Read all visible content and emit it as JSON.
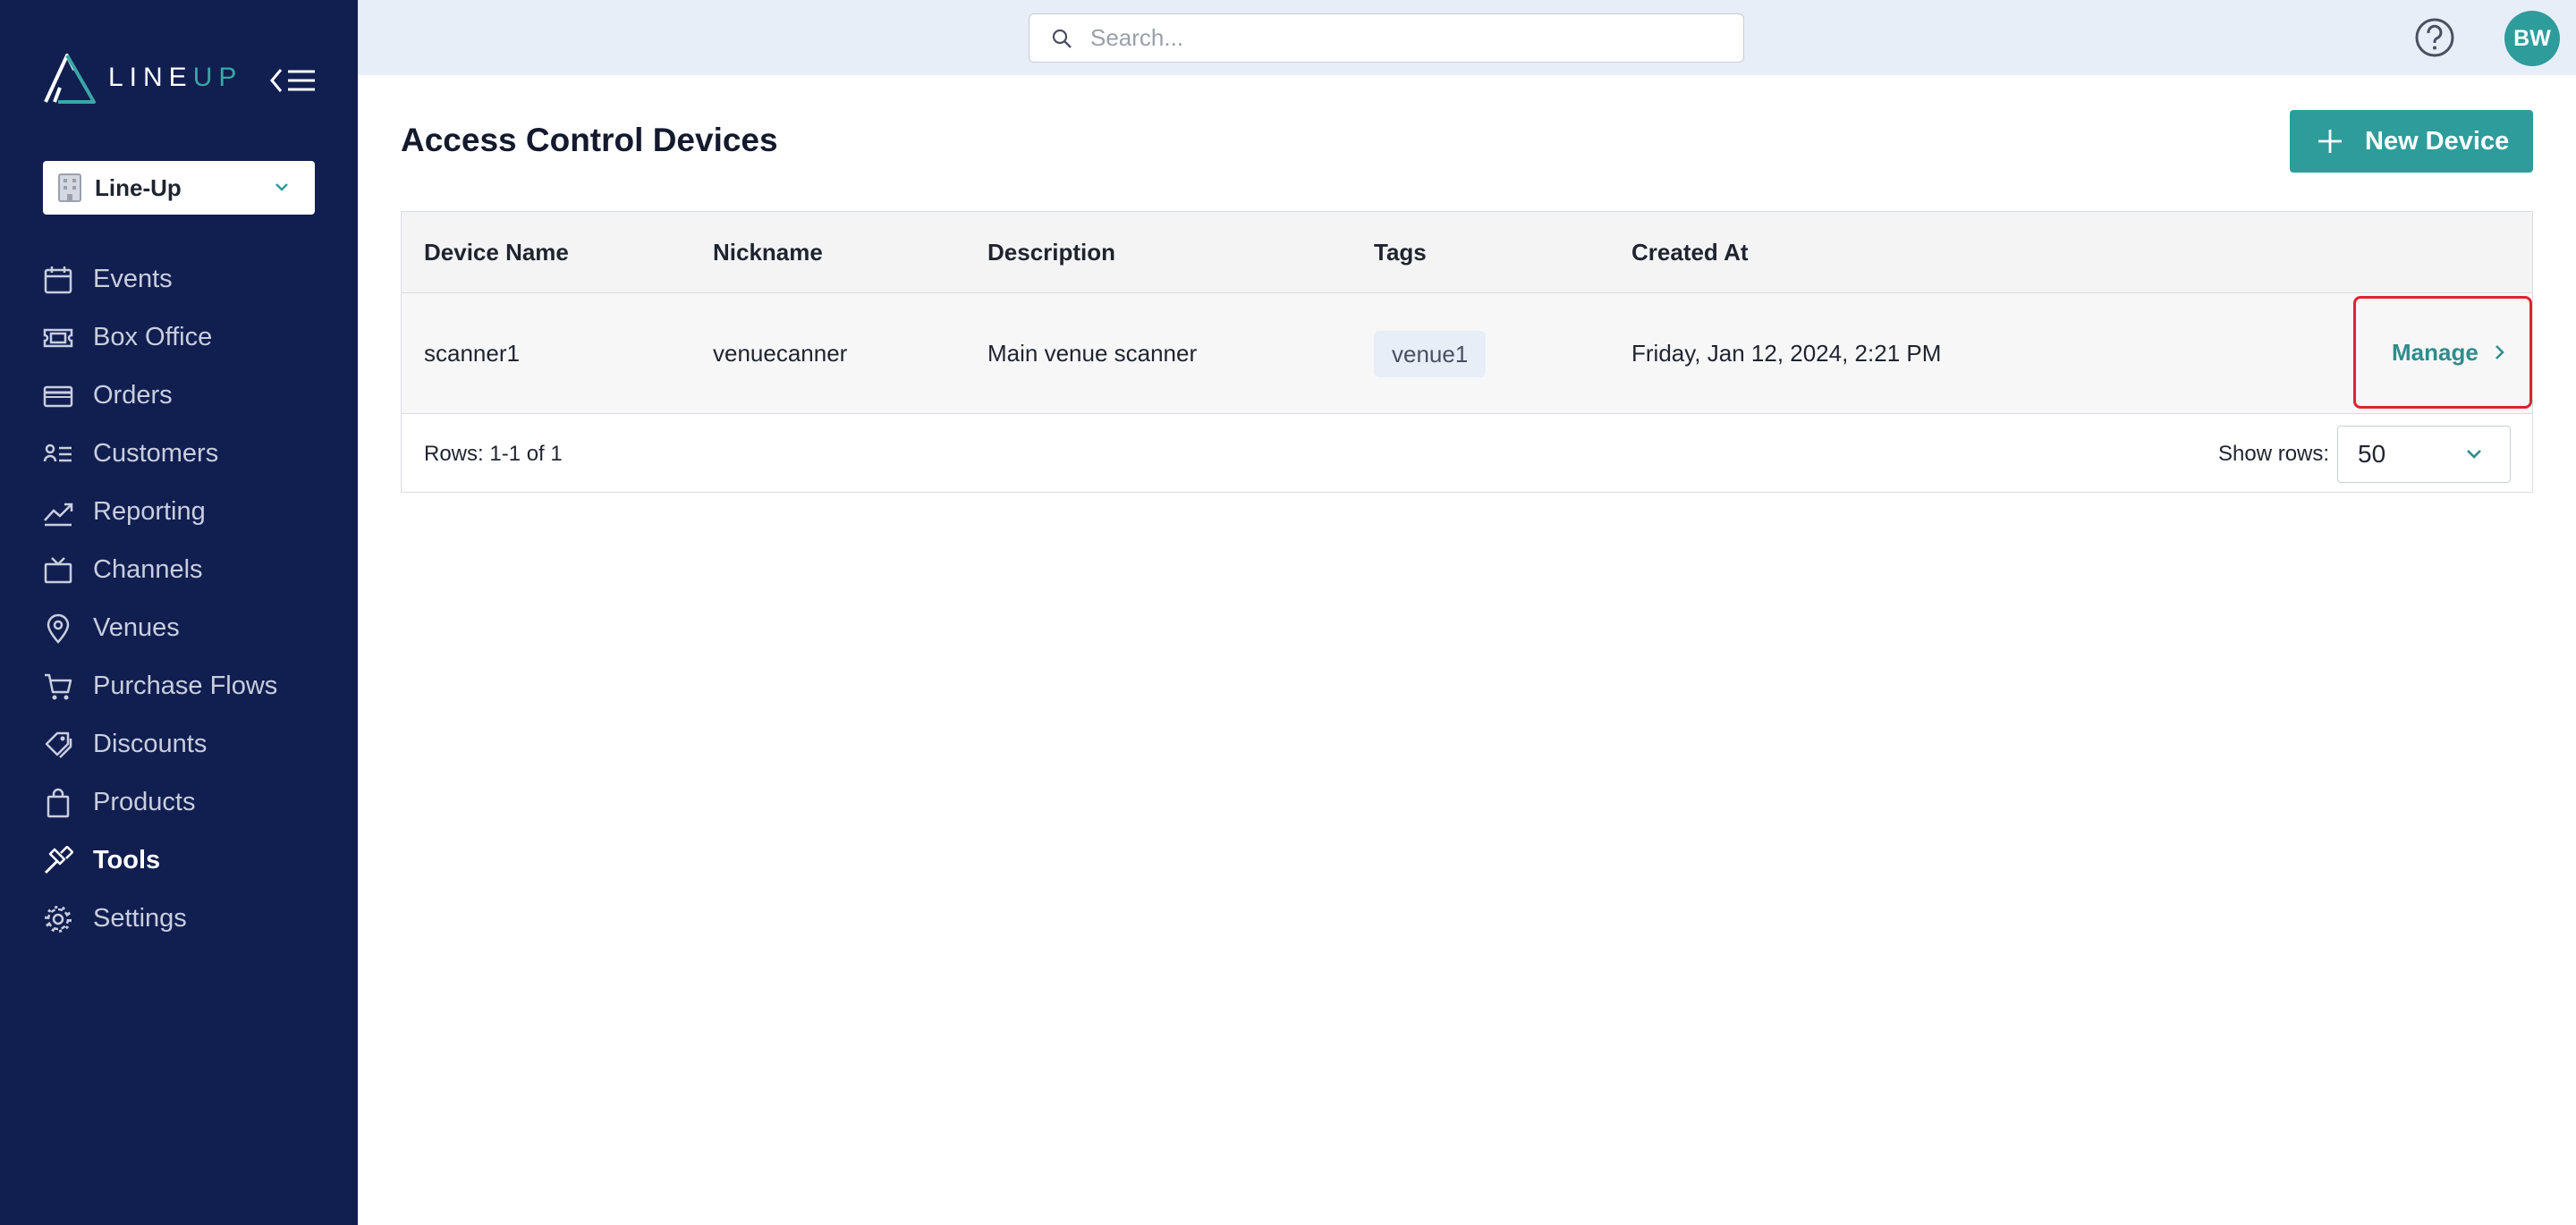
{
  "brand": {
    "logo_text_a": "LINE",
    "logo_text_b": "UP",
    "accent": "#2f9c9c",
    "sidebar_bg": "#111e50"
  },
  "sidebar": {
    "org_select": {
      "label": "Line-Up"
    },
    "items": [
      {
        "label": "Events",
        "icon": "calendar-icon",
        "active": false
      },
      {
        "label": "Box Office",
        "icon": "ticket-icon",
        "active": false
      },
      {
        "label": "Orders",
        "icon": "credit-card-icon",
        "active": false
      },
      {
        "label": "Customers",
        "icon": "customers-icon",
        "active": false
      },
      {
        "label": "Reporting",
        "icon": "trend-chart-icon",
        "active": false
      },
      {
        "label": "Channels",
        "icon": "tv-icon",
        "active": false
      },
      {
        "label": "Venues",
        "icon": "map-pin-icon",
        "active": false
      },
      {
        "label": "Purchase Flows",
        "icon": "cart-icon",
        "active": false
      },
      {
        "label": "Discounts",
        "icon": "tags-icon",
        "active": false
      },
      {
        "label": "Products",
        "icon": "shopping-bag-icon",
        "active": false
      },
      {
        "label": "Tools",
        "icon": "hammer-icon",
        "active": true
      },
      {
        "label": "Settings",
        "icon": "gear-icon",
        "active": false
      }
    ]
  },
  "topbar": {
    "search_placeholder": "Search...",
    "avatar_initials": "BW"
  },
  "main": {
    "title": "Access Control Devices",
    "new_device_label": "New Device",
    "table": {
      "columns": [
        "Device Name",
        "Nickname",
        "Description",
        "Tags",
        "Created At"
      ],
      "rows": [
        {
          "device_name": "scanner1",
          "nickname": "venuecanner",
          "description": "Main venue scanner",
          "tag": "venue1",
          "created_at": "Friday, Jan 12, 2024, 2:21 PM",
          "action_label": "Manage"
        }
      ],
      "rows_info": "Rows: 1-1 of 1",
      "show_rows_label": "Show rows:",
      "show_rows_value": "50"
    }
  }
}
